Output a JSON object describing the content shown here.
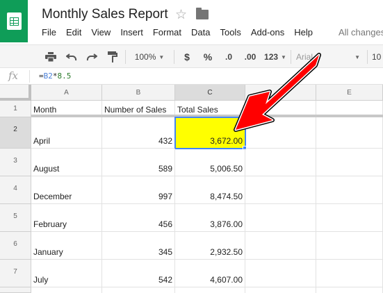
{
  "app": {
    "title": "Monthly Sales Report",
    "status": "All changes"
  },
  "menu": [
    "File",
    "Edit",
    "View",
    "Insert",
    "Format",
    "Data",
    "Tools",
    "Add-ons",
    "Help"
  ],
  "toolbar": {
    "zoom": "100%",
    "currency": "$",
    "percent": "%",
    "decrease_decimal": ".0",
    "increase_decimal": ".00",
    "more_formats": "123",
    "font": "Arial",
    "font_size": "10"
  },
  "formula": {
    "prefix": "=",
    "ref": "B2",
    "operator": "*",
    "number": "8.5"
  },
  "columns": [
    "A",
    "B",
    "C",
    "E"
  ],
  "rows": [
    {
      "num": "1",
      "month": "Month",
      "units": "Number of Sales",
      "total": "Total Sales"
    },
    {
      "num": "2",
      "month": "April",
      "units": "432",
      "total": "3,672.00"
    },
    {
      "num": "3",
      "month": "August",
      "units": "589",
      "total": "5,006.50"
    },
    {
      "num": "4",
      "month": "December",
      "units": "997",
      "total": "8,474.50"
    },
    {
      "num": "5",
      "month": "February",
      "units": "456",
      "total": "3,876.00"
    },
    {
      "num": "6",
      "month": "January",
      "units": "345",
      "total": "2,932.50"
    },
    {
      "num": "7",
      "month": "July",
      "units": "542",
      "total": "4,607.00"
    }
  ],
  "colors": {
    "brand": "#0f9d58",
    "selection": "#4285f4",
    "highlight": "#ffff00",
    "arrow": "#ff0000"
  }
}
